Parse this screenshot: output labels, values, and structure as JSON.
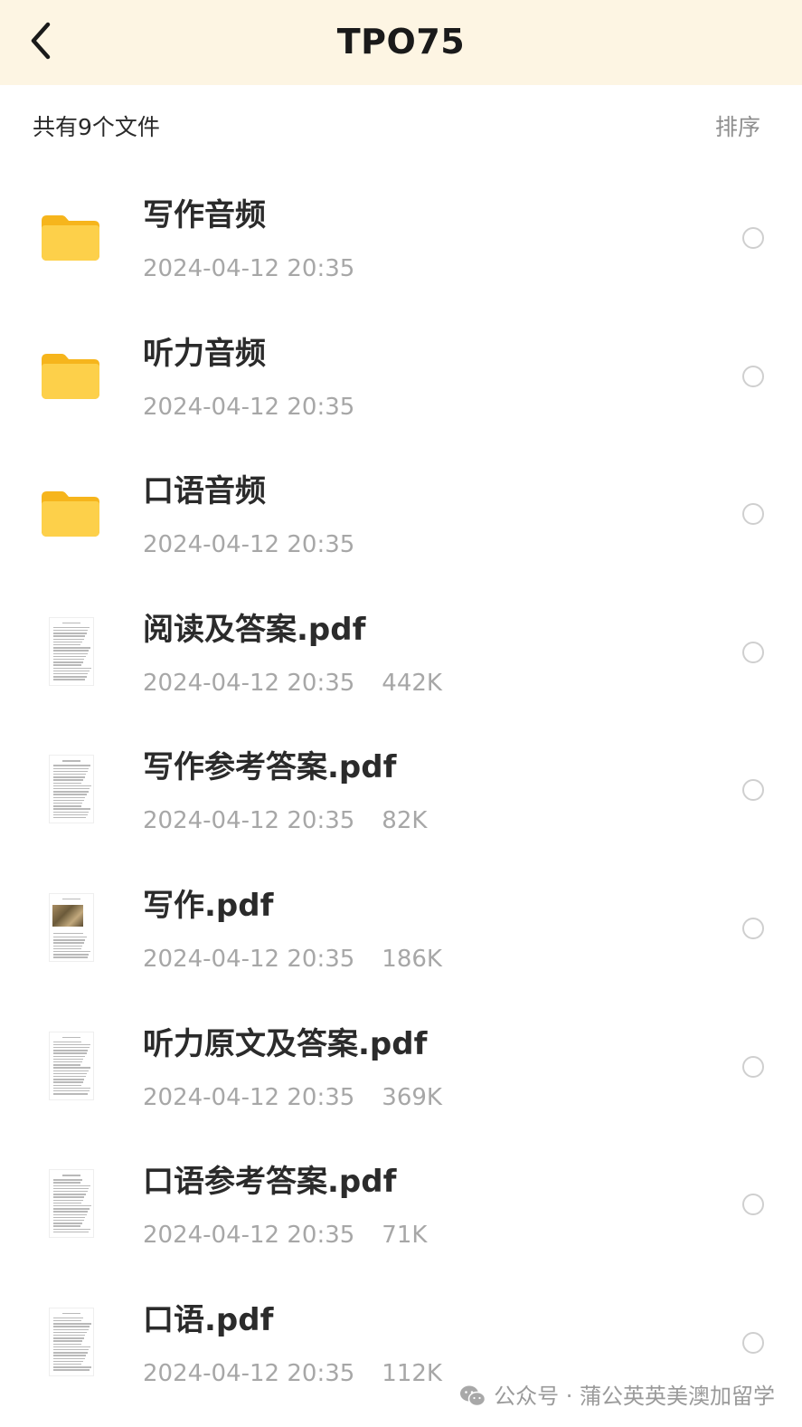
{
  "header": {
    "title": "TPO75",
    "back_icon": "chevron-left-icon"
  },
  "toolbar": {
    "file_count": "共有9个文件",
    "sort_label": "排序"
  },
  "files": [
    {
      "type": "folder",
      "name": "写作音频",
      "date": "2024-04-12 20:35",
      "size": ""
    },
    {
      "type": "folder",
      "name": "听力音频",
      "date": "2024-04-12 20:35",
      "size": ""
    },
    {
      "type": "folder",
      "name": "口语音频",
      "date": "2024-04-12 20:35",
      "size": ""
    },
    {
      "type": "pdf",
      "name": "阅读及答案.pdf",
      "date": "2024-04-12 20:35",
      "size": "442K"
    },
    {
      "type": "pdf",
      "name": "写作参考答案.pdf",
      "date": "2024-04-12 20:35",
      "size": "82K"
    },
    {
      "type": "pdf",
      "name": "写作.pdf",
      "date": "2024-04-12 20:35",
      "size": "186K"
    },
    {
      "type": "pdf",
      "name": "听力原文及答案.pdf",
      "date": "2024-04-12 20:35",
      "size": "369K"
    },
    {
      "type": "pdf",
      "name": "口语参考答案.pdf",
      "date": "2024-04-12 20:35",
      "size": "71K"
    },
    {
      "type": "pdf",
      "name": "口语.pdf",
      "date": "2024-04-12 20:35",
      "size": "112K"
    }
  ],
  "watermark": {
    "text": "公众号 · 蒲公英英美澳加留学",
    "icon": "wechat-icon"
  },
  "colors": {
    "header_bg": "#fdf5e3",
    "folder_yellow": "#fbc62e",
    "meta_gray": "#a7a7a7"
  }
}
